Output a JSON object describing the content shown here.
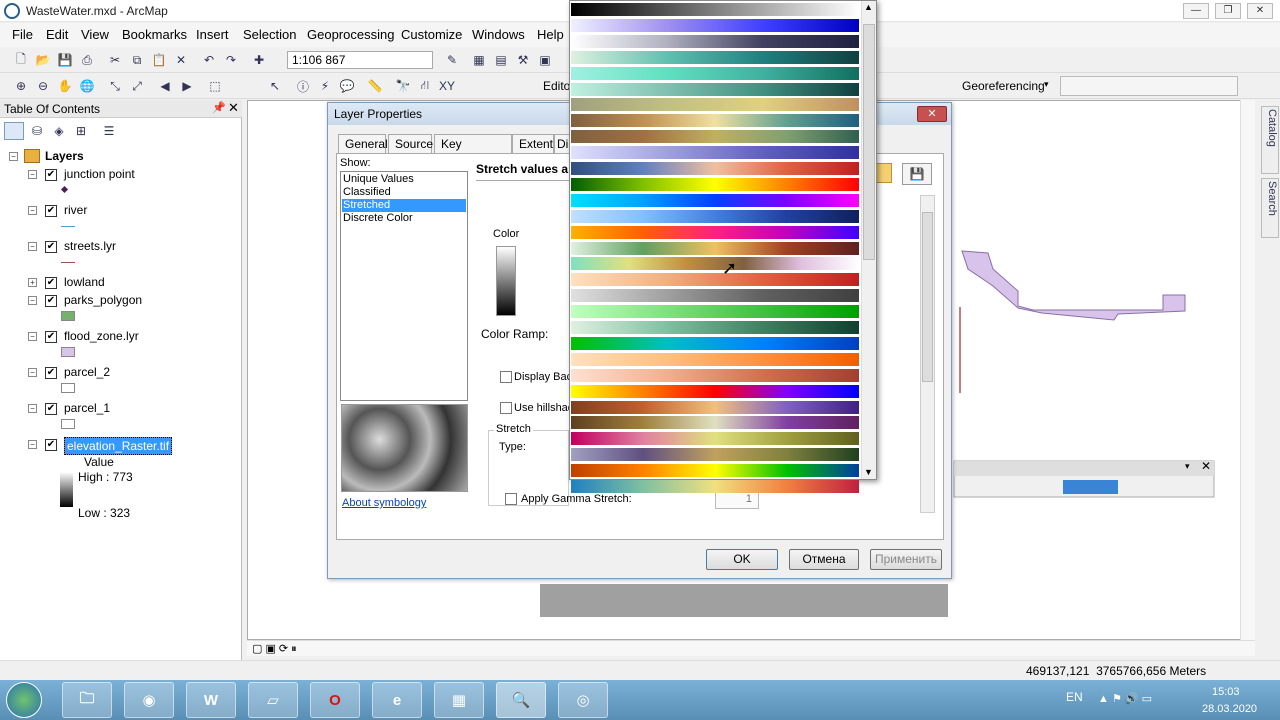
{
  "window": {
    "title": "WasteWater.mxd - ArcMap"
  },
  "menu": {
    "items": [
      "File",
      "Edit",
      "View",
      "Bookmarks",
      "Insert",
      "Selection",
      "Geoprocessing",
      "Customize",
      "Windows",
      "Help"
    ]
  },
  "toolbar": {
    "scale": "1:106 867",
    "editor_label": "Edito",
    "georeferencing_label": "Georeferencing"
  },
  "toc": {
    "title": "Table Of Contents",
    "root": "Layers",
    "layers": [
      {
        "name": "junction point",
        "checked": true,
        "swatch": "#4b1e5a"
      },
      {
        "name": "river",
        "checked": true,
        "swatch": "#4aa0d8"
      },
      {
        "name": "streets.lyr",
        "checked": true,
        "swatch": "#a05050"
      },
      {
        "name": "lowland",
        "checked": true,
        "swatch": ""
      },
      {
        "name": "parks_polygon",
        "checked": true,
        "swatch": "#78b070"
      },
      {
        "name": "flood_zone.lyr",
        "checked": true,
        "swatch": "#d8c3ea"
      },
      {
        "name": "parcel_2",
        "checked": true,
        "swatch": "#ffffff"
      },
      {
        "name": "parcel_1",
        "checked": true,
        "swatch": "#ffffff"
      },
      {
        "name": "elevation_Raster.tif",
        "checked": true,
        "swatch": ""
      }
    ],
    "raster_legend": {
      "value_label": "Value",
      "high": "High : 773",
      "low": "Low : 323"
    }
  },
  "dialog": {
    "title": "Layer Properties",
    "tabs": [
      "General",
      "Source",
      "Key Metadata",
      "Extent",
      "Di"
    ],
    "show_label": "Show:",
    "show_items": [
      "Unique Values",
      "Classified",
      "Stretched",
      "Discrete Color"
    ],
    "selected_show": "Stretched",
    "heading": "Stretch values a",
    "color_label": "Color",
    "color_ramp_label": "Color Ramp:",
    "display_background_label": "Display Bac",
    "use_hillshade_label": "Use hillshad",
    "stretch_label": "Stretch",
    "type_label": "Type:",
    "gamma_label": "Apply Gamma Stretch:",
    "gamma_value": "1",
    "about_link": "About symbology",
    "ok": "OK",
    "cancel": "Отмена",
    "apply": "Применить"
  },
  "status": {
    "coords": "469137,121  3765766,656 Meters"
  },
  "taskbar": {
    "lang": "EN",
    "time": "15:03",
    "date": "28.03.2020"
  },
  "side_tabs": [
    "Catalog",
    "Search"
  ],
  "color_ramps": [
    "linear-gradient(90deg,#000,#fff)",
    "linear-gradient(90deg,#f0f0ff,#a090f0,#4040ff,#0000c0)",
    "linear-gradient(90deg,#ffffff,#b0b0c0,#404060,#202040)",
    "linear-gradient(90deg,#e0f0e0,#60c0b0,#208080,#104040)",
    "linear-gradient(90deg,#a0f0e0,#60e0c0,#40b0a0,#107060)",
    "linear-gradient(90deg,#c0f0e0,#80c0b0,#409080,#104040)",
    "linear-gradient(90deg,#a0a080,#c0c080,#e0d080,#c09060)",
    "linear-gradient(90deg,#806040,#c09050,#f0e0a0,#60a090,#206080)",
    "linear-gradient(90deg,#806040,#a07040,#c0b060,#80a070,#306050)",
    "linear-gradient(90deg,#e0e0ff,#a0a0e0,#6060c0,#3030a0)",
    "linear-gradient(90deg,#305080,#6080c0,#f0c0a0,#e06040,#c02020)",
    "linear-gradient(90deg,#006000,#80c000,#ffff00,#ff8000,#ff0000)",
    "linear-gradient(90deg,#00e0ff,#00a0ff,#0040ff,#8000ff,#ff00ff)",
    "linear-gradient(90deg,#c0e0ff,#80c0ff,#4080e0,#2040a0,#102060)",
    "linear-gradient(90deg,#ffb000,#ff6000,#ff2080,#c000c0,#4000ff)",
    "linear-gradient(90deg,#e0f0e0,#60a060,#f0c060,#a04020,#602020)",
    "linear-gradient(90deg,#80e0c0,#e0e080,#c09040,#806040,#e0c0e0,#fff)",
    "linear-gradient(90deg,#ffe0c0,#f0b080,#e06040,#c02020)",
    "linear-gradient(90deg,#e0e0e0,#a0a0a0,#606060,#404040)",
    "linear-gradient(90deg,#c0ffc0,#80e080,#40c040,#00a000)",
    "linear-gradient(90deg,#e0f0e0,#80c0a0,#408060,#104030)",
    "linear-gradient(90deg,#00c000,#00c0c0,#0080ff,#0040c0)",
    "linear-gradient(90deg,#ffe0c0,#ffc080,#ff9040,#f06000)",
    "linear-gradient(90deg,#ffe0d0,#f0b090,#d07050,#a04030)",
    "linear-gradient(90deg,#ffff00,#ff8000,#ff0000,#8000ff,#0000ff)",
    "linear-gradient(90deg,#804020,#c06030,#f0c080,#8060c0,#402080)",
    "linear-gradient(90deg,#604020,#a08040,#e0e0c0,#8040a0,#602060)",
    "linear-gradient(90deg,#c00060,#e080a0,#e0e080,#a0a040,#606020)",
    "linear-gradient(90deg,#a0a0c0,#605080,#c0a060,#808040,#204020)",
    "linear-gradient(90deg,#c04000,#ff8000,#ffff00,#00c000,#0040a0)",
    "linear-gradient(90deg,#2080c0,#80c0a0,#f0e080,#f08040,#c02040)"
  ]
}
